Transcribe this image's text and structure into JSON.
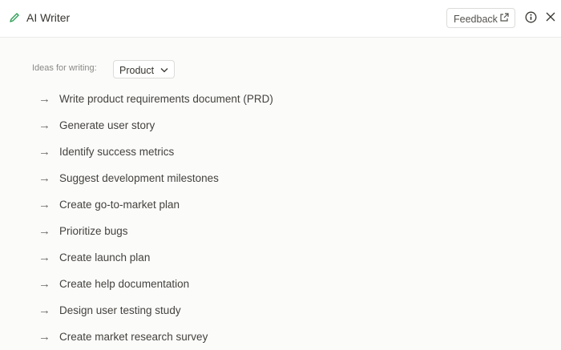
{
  "header": {
    "title": "AI Writer",
    "feedback_label": "Feedback"
  },
  "ideas": {
    "label": "Ideas for writing:",
    "selected": "Product"
  },
  "items": [
    "Write product requirements document (PRD)",
    "Generate user story",
    "Identify success metrics",
    "Suggest development milestones",
    "Create go-to-market plan",
    "Prioritize bugs",
    "Create launch plan",
    "Create help documentation",
    "Design user testing study",
    "Create market research survey"
  ],
  "colors": {
    "accent": "#2e9d57"
  }
}
